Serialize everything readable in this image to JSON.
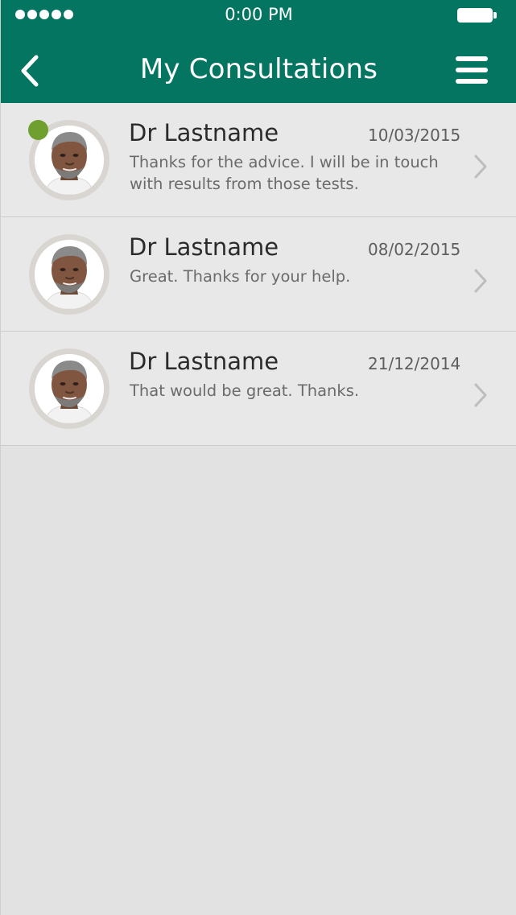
{
  "status_bar": {
    "time": "0:00 PM",
    "signal_bars": 5
  },
  "header": {
    "title": "My Consultations",
    "back_icon": "chevron-left-icon",
    "menu_icon": "hamburger-menu-icon"
  },
  "colors": {
    "header": "#037561",
    "online": "#6e9f2f",
    "background": "#e2e2e2",
    "row": "#e8e8e8"
  },
  "consultations": [
    {
      "name": "Dr Lastname",
      "date": "10/03/2015",
      "message": "Thanks for the advice. I will be in touch with results from those tests.",
      "online": true
    },
    {
      "name": "Dr Lastname",
      "date": "08/02/2015",
      "message": "Great. Thanks for your help.",
      "online": false
    },
    {
      "name": "Dr Lastname",
      "date": "21/12/2014",
      "message": "That would be great. Thanks.",
      "online": false
    }
  ]
}
